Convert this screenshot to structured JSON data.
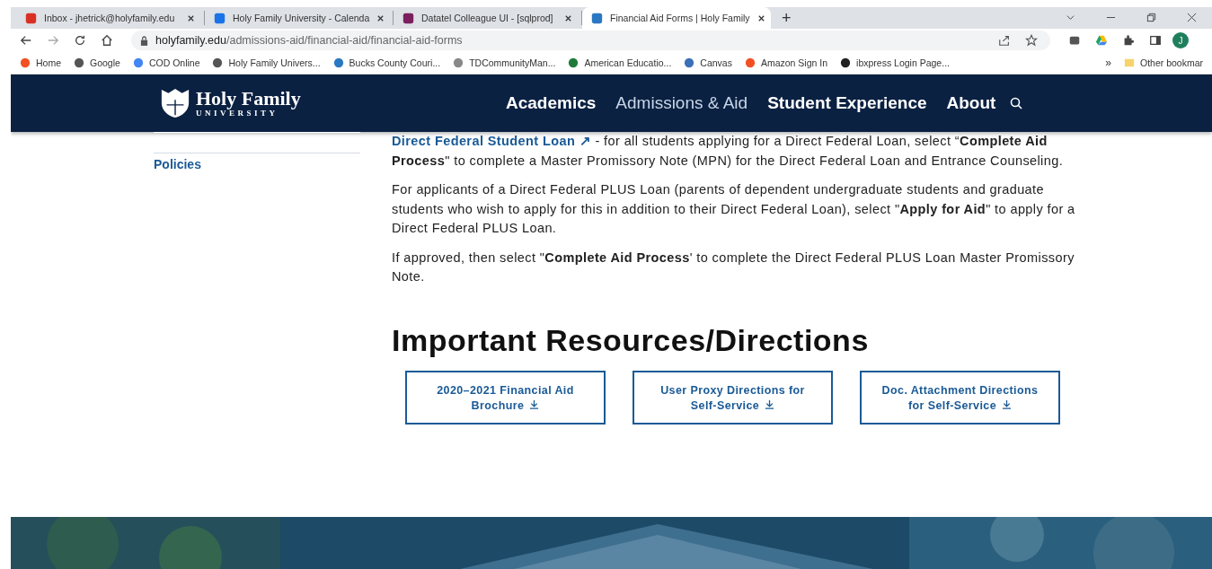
{
  "browser": {
    "tabs": [
      {
        "title": "Inbox - jhetrick@holyfamily.edu",
        "selected": false
      },
      {
        "title": "Holy Family University - Calenda",
        "selected": false
      },
      {
        "title": "Datatel Colleague UI - [sqlprod]",
        "selected": false
      },
      {
        "title": "Financial Aid Forms | Holy Family",
        "selected": true
      }
    ],
    "new_tab": "+",
    "url": {
      "host": "holyfamily.edu",
      "path": "/admissions-aid/financial-aid/financial-aid-forms"
    },
    "profile": "J",
    "bookmarks": [
      "Home",
      "Google",
      "COD Online",
      "Holy Family Univers...",
      "Bucks County Couri...",
      "TDCommunityMan...",
      "American Educatio...",
      "Canvas",
      "Amazon Sign In",
      "ibxpress Login Page..."
    ],
    "more_bookmarks": "»",
    "other_bookmarks": "Other bookmar"
  },
  "site": {
    "logo": {
      "name": "Holy Family",
      "sub": "UNIVERSITY"
    },
    "nav": [
      {
        "label": "Academics",
        "selected": false
      },
      {
        "label": "Admissions & Aid",
        "selected": true
      },
      {
        "label": "Student Experience",
        "selected": false
      },
      {
        "label": "About",
        "selected": false
      }
    ],
    "sidebar": [
      "Policies"
    ],
    "paragraphs": [
      {
        "link": "Direct Federal Student Loan",
        "link_icon": "↗",
        "text": " - for all students applying for a Direct Federal Loan, select “**Complete Aid Process**\" to complete a Master Promissory Note (MPN) for the Direct Federal Loan and  Entrance Counseling."
      },
      {
        "text": "For applicants of a Direct Federal PLUS Loan (parents of dependent undergraduate students and graduate students who wish to apply for this in addition to their Direct Federal Loan), select \"**Apply for Aid**\" to apply for a Direct Federal PLUS Loan."
      },
      {
        "text": "If approved, then select \"**Complete Aid Process**' to complete the Direct Federal PLUS Loan Master Promissory Note."
      }
    ],
    "heading": "Important Resources/Directions",
    "downloads": [
      {
        "line1": "2020–2021 Financial Aid",
        "line2": "Brochure"
      },
      {
        "line1": "User Proxy Directions for",
        "line2": "Self-Service"
      },
      {
        "line1": "Doc. Attachment Directions",
        "line2": "for Self-Service"
      }
    ]
  }
}
